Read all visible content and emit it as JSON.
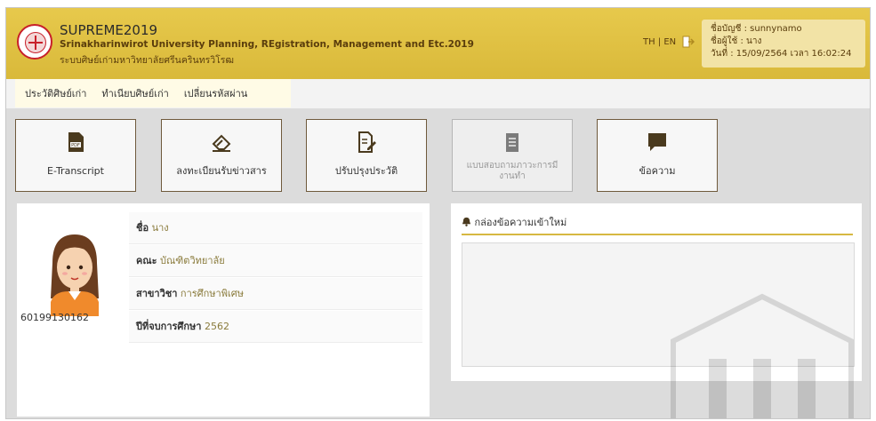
{
  "header": {
    "app_title": "SUPREME2019",
    "subtitle_en": "Srinakharinwirot University Planning, REgistration, Management and Etc.2019",
    "subtitle_th": "ระบบศิษย์เก่ามหาวิทยาลัยศรีนครินทรวิโรฒ",
    "lang_label": "TH | EN",
    "account": {
      "account_line": "ชื่อบัญชี : sunnynamo",
      "user_line": "ชื่อผู้ใช้ : นาง",
      "date_line": "วันที่ : 15/09/2564 เวลา 16:02:24"
    },
    "colors": {
      "header_bg": "#d9b93a",
      "accent": "#c8202a"
    }
  },
  "nav": {
    "items": [
      "ประวัติศิษย์เก่า",
      "ทำเนียบศิษย์เก่า",
      "เปลี่ยนรหัสผ่าน"
    ]
  },
  "tiles": [
    {
      "label": "E-Transcript",
      "icon": "pdf-icon"
    },
    {
      "label": "ลงทะเบียนรับข่าวสาร",
      "icon": "eraser-icon"
    },
    {
      "label": "ปรับปรุงประวัติ",
      "icon": "edit-document-icon"
    },
    {
      "label": "แบบสอบถามภาวะการมีงานทำ",
      "icon": "clipboard-icon",
      "disabled": true
    },
    {
      "label": "ข้อความ",
      "icon": "message-icon"
    }
  ],
  "profile": {
    "student_id": "60199130162",
    "fields": [
      {
        "label": "ชื่อ",
        "value": "นาง"
      },
      {
        "label": "คณะ",
        "value": "บัณฑิตวิทยาลัย"
      },
      {
        "label": "สาขาวิชา",
        "value": "การศึกษาพิเศษ"
      },
      {
        "label": "ปีที่จบการศึกษา",
        "value": "2562"
      }
    ]
  },
  "messages": {
    "title": "กล่องข้อความเข้าใหม่",
    "icon": "bell-icon"
  }
}
